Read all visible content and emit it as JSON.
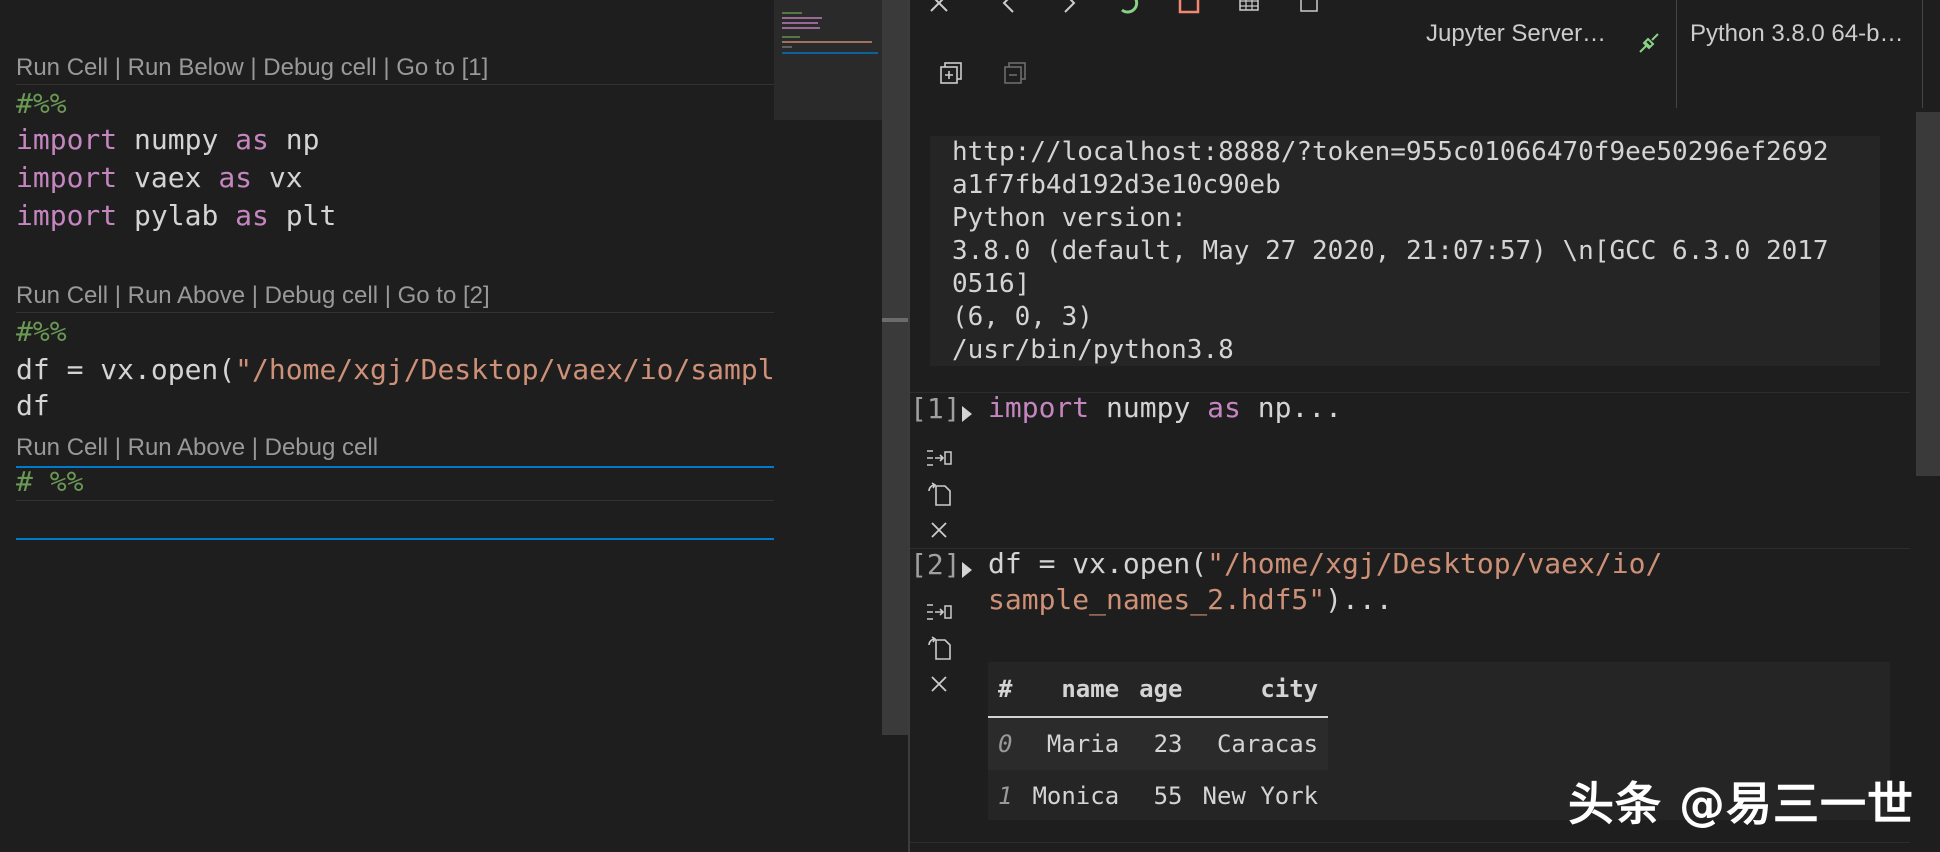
{
  "editor": {
    "cell1_lens": [
      "Run Cell",
      "Run Below",
      "Debug cell",
      "Go to [1]"
    ],
    "cell1_marker": "#%%",
    "cell1_lines": [
      {
        "kw1": "import",
        "mid": " numpy ",
        "kw2": "as",
        "end": " np"
      },
      {
        "kw1": "import",
        "mid": " vaex ",
        "kw2": "as",
        "end": " vx"
      },
      {
        "kw1": "import",
        "mid": " pylab ",
        "kw2": "as",
        "end": " plt"
      }
    ],
    "cell2_lens": [
      "Run Cell",
      "Run Above",
      "Debug cell",
      "Go to [2]"
    ],
    "cell2_marker": "#%%",
    "cell2_line1_pre": "df = vx.open(",
    "cell2_line1_str": "\"/home/xgj/Desktop/vaex/io/sampl",
    "cell2_line2": "df",
    "cell3_lens": [
      "Run Cell",
      "Run Above",
      "Debug cell"
    ],
    "cell3_marker": "# %%"
  },
  "interactive": {
    "server_label": "Jupyter Server…",
    "kernel_label": "Python 3.8.0 64-b…",
    "info_lines": [
      "http://localhost:8888/?token=955c01066470f9ee50296ef2692",
      "a1f7fb4d192d3e10c90eb",
      "Python version:",
      "3.8.0 (default, May 27 2020, 21:07:57) \\n[GCC 6.3.0 2017",
      "0516]",
      "(6, 0, 3)",
      "/usr/bin/python3.8"
    ],
    "cells": [
      {
        "count": "[1]",
        "kw": "import",
        "rest": " numpy ",
        "kw2": "as",
        "tail": " np..."
      },
      {
        "count": "[2]",
        "pre": "df = vx.open(",
        "str1": "\"/home/xgj/Desktop/vaex/io/",
        "str2": "sample_names_2.hdf5\"",
        "tail": ")..."
      }
    ],
    "table": {
      "headers": [
        "#",
        "name",
        "age",
        "city"
      ],
      "rows": [
        [
          "0",
          "Maria",
          "23",
          "Caracas"
        ],
        [
          "1",
          "Monica",
          "55",
          "New York"
        ]
      ]
    }
  },
  "watermark": "头条 @易三一世"
}
